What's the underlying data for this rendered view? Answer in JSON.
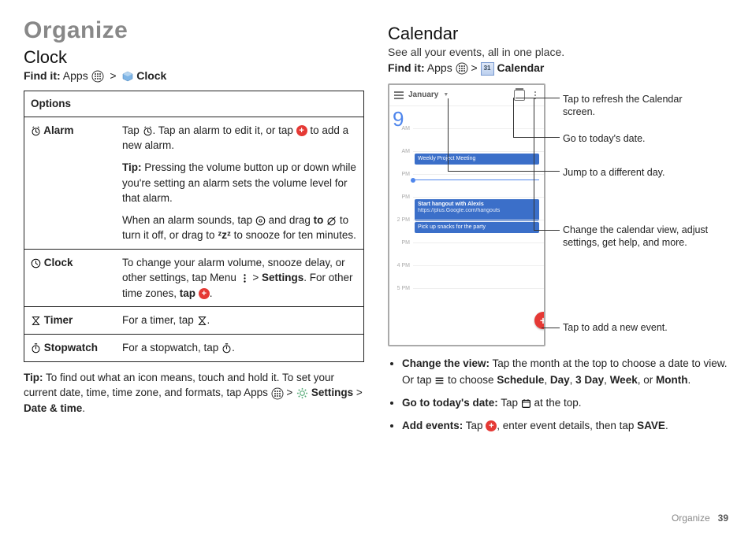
{
  "page": {
    "title": "Organize",
    "footer_label": "Organize",
    "page_number": "39"
  },
  "clock": {
    "heading": "Clock",
    "find_label": "Find it:",
    "find_prefix": "Apps",
    "find_target": "Clock",
    "table_header": "Options",
    "rows": {
      "alarm": {
        "label": "Alarm",
        "p1a": "Tap ",
        "p1b": ". Tap an alarm to edit it, or tap ",
        "p1c": " to add a new alarm.",
        "p2": "Tip: Pressing the volume button up or down while you're setting an alarm sets the volume level for that alarm.",
        "p3a": "When an alarm sounds, tap ",
        "p3b": " and drag ",
        "p3to": "to",
        "p3c": " to turn it off, or drag to ",
        "p3snooze": "ᶻzᶻ",
        "p3d": " to snooze for ten minutes."
      },
      "clock": {
        "label": "Clock",
        "p1a": "To change your alarm volume, snooze delay, or other settings, tap Menu ",
        "p1b": " > ",
        "p1settings": "Settings",
        "p1c": ". For other time zones, ",
        "p1tap": "tap",
        "p1d": " ",
        "p1e": "."
      },
      "timer": {
        "label": "Timer",
        "p1a": "For a timer, tap ",
        "p1b": "."
      },
      "stopwatch": {
        "label": "Stopwatch",
        "p1a": "For a stopwatch, tap ",
        "p1b": "."
      }
    },
    "tip_prefix": "Tip:",
    "tip_body_a": " To find out what an icon means, touch and hold it. To set your current date, time, time zone, and formats, tap Apps ",
    "tip_body_b": " > ",
    "tip_settings": "Settings",
    "tip_body_c": " > ",
    "tip_datetime": "Date & time",
    "tip_body_d": "."
  },
  "calendar": {
    "heading": "Calendar",
    "lead": "See all your events, all in one place.",
    "find_label": "Find it:",
    "find_prefix": "Apps",
    "find_target": "Calendar",
    "mock": {
      "month": "January",
      "day_number": "9",
      "events": {
        "e1": "Weekly Project Meeting",
        "e2_title": "Start hangout with Alexis",
        "e2_sub": "https://plus.Google.com/hangouts",
        "e3": "Pick up snacks for the party"
      },
      "times": [
        "AM",
        "AM",
        "PM",
        "PM",
        "2 PM",
        "PM",
        "4 PM",
        "5 PM"
      ]
    },
    "annos": {
      "a1": "Tap to refresh the Calendar screen.",
      "a2": "Go to today's date.",
      "a3": "Jump to a different day.",
      "a4": "Change the calendar view, adjust settings, get help, and more.",
      "a5": "Tap to add a new event."
    },
    "bullets": {
      "b1_lead": "Change the view:",
      "b1_a": " Tap the month at the top to choose a date to view. Or tap ",
      "b1_b": " to choose ",
      "b1_opts": [
        "Schedule",
        "Day",
        "3 Day",
        "Week",
        "Month"
      ],
      "b2_lead": "Go to today's date:",
      "b2_a": " Tap ",
      "b2_b": " at the top.",
      "b3_lead": "Add events:",
      "b3_a": " Tap ",
      "b3_b": ", enter event details, then tap ",
      "b3_save": "SAVE",
      "b3_c": "."
    }
  }
}
